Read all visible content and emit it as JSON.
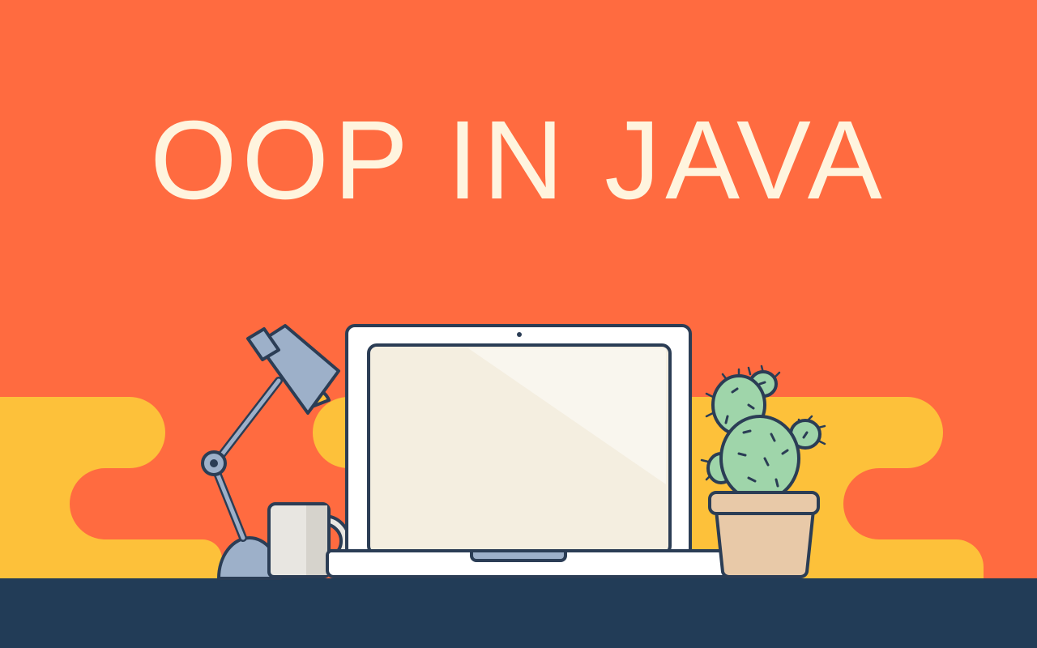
{
  "title": "OOP IN JAVA",
  "colors": {
    "background": "#FF6B40",
    "cloud": "#FDC13A",
    "desk": "#223C57",
    "title_text": "#FFF4DE",
    "outline": "#2B3D55",
    "laptop_body": "#FFFFFF",
    "laptop_screen": "#F4EEE0",
    "lamp": "#9DB0C9",
    "mug": "#E8E6E1",
    "cactus": "#9FD5AA",
    "pot": "#E8C9A8"
  },
  "illustration": {
    "objects": [
      "desk-lamp-icon",
      "coffee-mug-icon",
      "laptop-icon",
      "cactus-icon",
      "plant-pot-icon"
    ]
  }
}
